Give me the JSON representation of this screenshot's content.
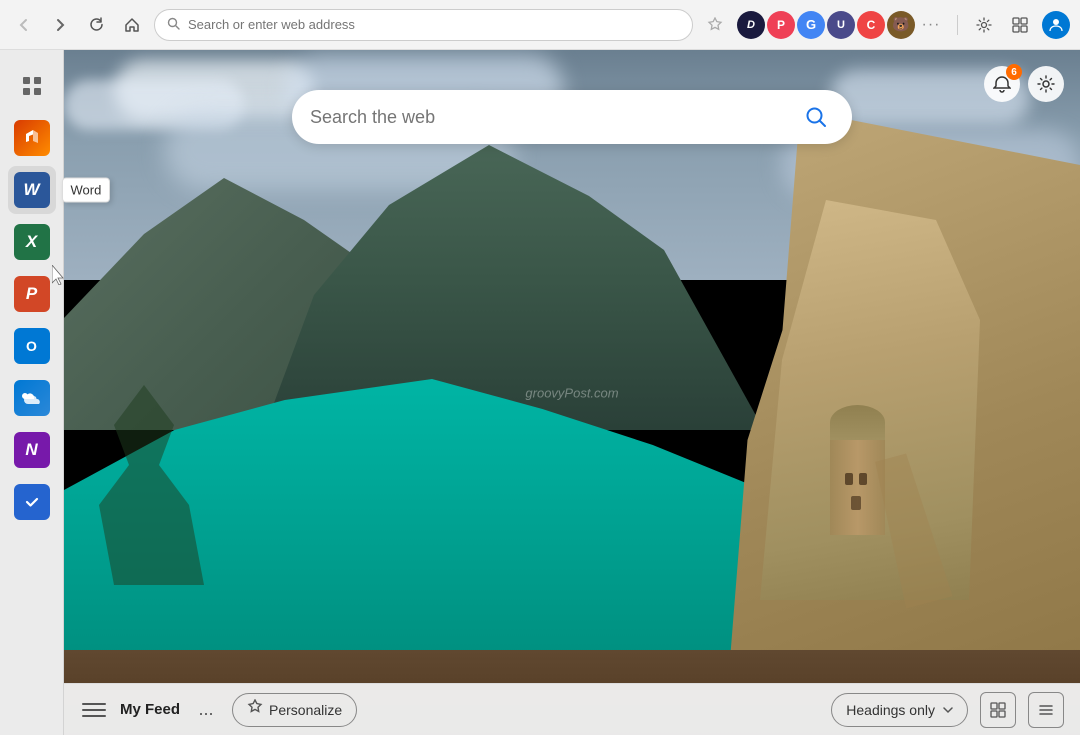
{
  "browser": {
    "back_disabled": true,
    "forward_disabled": true,
    "address_placeholder": "Search or enter web address",
    "address_value": "",
    "toolbar_icons": [
      "star",
      "D",
      "pocket",
      "G",
      "U",
      "C",
      "bear",
      "dots",
      "gear",
      "tabs",
      "profile"
    ]
  },
  "sidebar": {
    "items": [
      {
        "id": "grid-menu",
        "label": "Apps menu",
        "icon": "grid"
      },
      {
        "id": "office",
        "label": "Microsoft 365",
        "icon": "office",
        "letter": ""
      },
      {
        "id": "word",
        "label": "Word",
        "icon": "word",
        "letter": "W"
      },
      {
        "id": "excel",
        "label": "Excel",
        "icon": "excel",
        "letter": "X"
      },
      {
        "id": "powerpoint",
        "label": "PowerPoint",
        "icon": "powerpoint",
        "letter": "P"
      },
      {
        "id": "outlook",
        "label": "Outlook",
        "icon": "outlook",
        "letter": "O"
      },
      {
        "id": "onedrive",
        "label": "OneDrive",
        "icon": "onedrive",
        "letter": "☁"
      },
      {
        "id": "onenote",
        "label": "OneNote",
        "icon": "onenote",
        "letter": "N"
      },
      {
        "id": "todo",
        "label": "To Do",
        "icon": "todo",
        "letter": "✓"
      }
    ],
    "tooltip": {
      "visible": true,
      "text": "Word",
      "target": "word"
    }
  },
  "main": {
    "search_placeholder": "Search the web",
    "search_value": "",
    "watermark": "groovyPost.com",
    "notifications": {
      "count": 6
    }
  },
  "bottom_bar": {
    "my_feed_label": "My Feed",
    "dots_label": "...",
    "personalize_label": "Personalize",
    "headings_only_label": "Headings only",
    "chevron": "▼"
  }
}
